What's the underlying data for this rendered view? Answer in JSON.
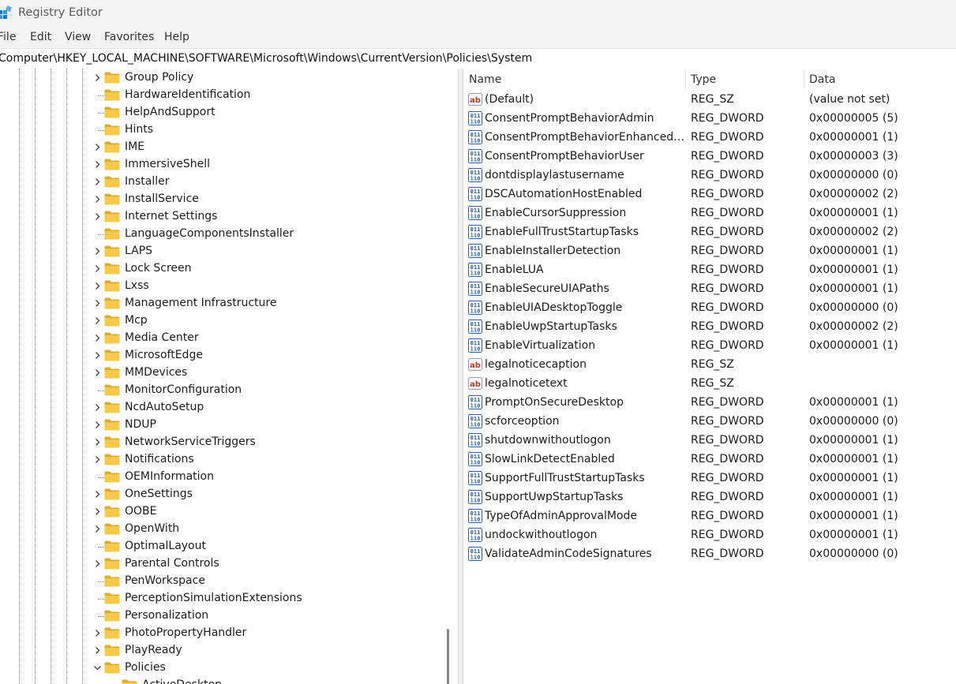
{
  "window": {
    "title": "Registry Editor"
  },
  "menu": [
    "File",
    "Edit",
    "View",
    "Favorites",
    "Help"
  ],
  "address": "Computer\\HKEY_LOCAL_MACHINE\\SOFTWARE\\Microsoft\\Windows\\CurrentVersion\\Policies\\System",
  "tree": {
    "items": [
      {
        "label": "Group Policy",
        "state": "collapsed"
      },
      {
        "label": "HardwareIdentification",
        "state": "leaf"
      },
      {
        "label": "HelpAndSupport",
        "state": "leaf"
      },
      {
        "label": "Hints",
        "state": "leaf"
      },
      {
        "label": "IME",
        "state": "collapsed"
      },
      {
        "label": "ImmersiveShell",
        "state": "collapsed"
      },
      {
        "label": "Installer",
        "state": "collapsed"
      },
      {
        "label": "InstallService",
        "state": "collapsed"
      },
      {
        "label": "Internet Settings",
        "state": "collapsed"
      },
      {
        "label": "LanguageComponentsInstaller",
        "state": "leaf"
      },
      {
        "label": "LAPS",
        "state": "collapsed"
      },
      {
        "label": "Lock Screen",
        "state": "collapsed"
      },
      {
        "label": "Lxss",
        "state": "collapsed"
      },
      {
        "label": "Management Infrastructure",
        "state": "collapsed"
      },
      {
        "label": "Mcp",
        "state": "collapsed"
      },
      {
        "label": "Media Center",
        "state": "collapsed"
      },
      {
        "label": "MicrosoftEdge",
        "state": "collapsed"
      },
      {
        "label": "MMDevices",
        "state": "collapsed"
      },
      {
        "label": "MonitorConfiguration",
        "state": "leaf"
      },
      {
        "label": "NcdAutoSetup",
        "state": "collapsed"
      },
      {
        "label": "NDUP",
        "state": "collapsed"
      },
      {
        "label": "NetworkServiceTriggers",
        "state": "collapsed"
      },
      {
        "label": "Notifications",
        "state": "collapsed"
      },
      {
        "label": "OEMInformation",
        "state": "leaf"
      },
      {
        "label": "OneSettings",
        "state": "collapsed"
      },
      {
        "label": "OOBE",
        "state": "collapsed"
      },
      {
        "label": "OpenWith",
        "state": "collapsed"
      },
      {
        "label": "OptimalLayout",
        "state": "leaf"
      },
      {
        "label": "Parental Controls",
        "state": "collapsed"
      },
      {
        "label": "PenWorkspace",
        "state": "leaf"
      },
      {
        "label": "PerceptionSimulationExtensions",
        "state": "leaf"
      },
      {
        "label": "Personalization",
        "state": "leaf"
      },
      {
        "label": "PhotoPropertyHandler",
        "state": "collapsed"
      },
      {
        "label": "PlayReady",
        "state": "collapsed"
      },
      {
        "label": "Policies",
        "state": "expanded"
      },
      {
        "label": "ActiveDesktop",
        "state": "leaf",
        "child": true
      }
    ]
  },
  "list": {
    "columns": {
      "name": "Name",
      "type": "Type",
      "data": "Data"
    },
    "rows": [
      {
        "icon": "string-value-icon",
        "name": "(Default)",
        "type": "REG_SZ",
        "data": "(value not set)"
      },
      {
        "icon": "binary-value-icon",
        "name": "ConsentPromptBehaviorAdmin",
        "type": "REG_DWORD",
        "data": "0x00000005 (5)"
      },
      {
        "icon": "binary-value-icon",
        "name": "ConsentPromptBehaviorEnhancedAd...",
        "type": "REG_DWORD",
        "data": "0x00000001 (1)"
      },
      {
        "icon": "binary-value-icon",
        "name": "ConsentPromptBehaviorUser",
        "type": "REG_DWORD",
        "data": "0x00000003 (3)"
      },
      {
        "icon": "binary-value-icon",
        "name": "dontdisplaylastusername",
        "type": "REG_DWORD",
        "data": "0x00000000 (0)"
      },
      {
        "icon": "binary-value-icon",
        "name": "DSCAutomationHostEnabled",
        "type": "REG_DWORD",
        "data": "0x00000002 (2)"
      },
      {
        "icon": "binary-value-icon",
        "name": "EnableCursorSuppression",
        "type": "REG_DWORD",
        "data": "0x00000001 (1)"
      },
      {
        "icon": "binary-value-icon",
        "name": "EnableFullTrustStartupTasks",
        "type": "REG_DWORD",
        "data": "0x00000002 (2)"
      },
      {
        "icon": "binary-value-icon",
        "name": "EnableInstallerDetection",
        "type": "REG_DWORD",
        "data": "0x00000001 (1)"
      },
      {
        "icon": "binary-value-icon",
        "name": "EnableLUA",
        "type": "REG_DWORD",
        "data": "0x00000001 (1)"
      },
      {
        "icon": "binary-value-icon",
        "name": "EnableSecureUIAPaths",
        "type": "REG_DWORD",
        "data": "0x00000001 (1)"
      },
      {
        "icon": "binary-value-icon",
        "name": "EnableUIADesktopToggle",
        "type": "REG_DWORD",
        "data": "0x00000000 (0)"
      },
      {
        "icon": "binary-value-icon",
        "name": "EnableUwpStartupTasks",
        "type": "REG_DWORD",
        "data": "0x00000002 (2)"
      },
      {
        "icon": "binary-value-icon",
        "name": "EnableVirtualization",
        "type": "REG_DWORD",
        "data": "0x00000001 (1)"
      },
      {
        "icon": "string-value-icon",
        "name": "legalnoticecaption",
        "type": "REG_SZ",
        "data": ""
      },
      {
        "icon": "string-value-icon",
        "name": "legalnoticetext",
        "type": "REG_SZ",
        "data": ""
      },
      {
        "icon": "binary-value-icon",
        "name": "PromptOnSecureDesktop",
        "type": "REG_DWORD",
        "data": "0x00000001 (1)"
      },
      {
        "icon": "binary-value-icon",
        "name": "scforceoption",
        "type": "REG_DWORD",
        "data": "0x00000000 (0)"
      },
      {
        "icon": "binary-value-icon",
        "name": "shutdownwithoutlogon",
        "type": "REG_DWORD",
        "data": "0x00000001 (1)"
      },
      {
        "icon": "binary-value-icon",
        "name": "SlowLinkDetectEnabled",
        "type": "REG_DWORD",
        "data": "0x00000001 (1)"
      },
      {
        "icon": "binary-value-icon",
        "name": "SupportFullTrustStartupTasks",
        "type": "REG_DWORD",
        "data": "0x00000001 (1)"
      },
      {
        "icon": "binary-value-icon",
        "name": "SupportUwpStartupTasks",
        "type": "REG_DWORD",
        "data": "0x00000001 (1)"
      },
      {
        "icon": "binary-value-icon",
        "name": "TypeOfAdminApprovalMode",
        "type": "REG_DWORD",
        "data": "0x00000001 (1)"
      },
      {
        "icon": "binary-value-icon",
        "name": "undockwithoutlogon",
        "type": "REG_DWORD",
        "data": "0x00000001 (1)"
      },
      {
        "icon": "binary-value-icon",
        "name": "ValidateAdminCodeSignatures",
        "type": "REG_DWORD",
        "data": "0x00000000 (0)"
      }
    ]
  },
  "colors": {
    "folder": "#f7c948",
    "folder_dark": "#e0a82e",
    "string_icon": "#c0392b",
    "binary_icon": "#2f5fa8",
    "app_icon": "#1e74c8"
  }
}
